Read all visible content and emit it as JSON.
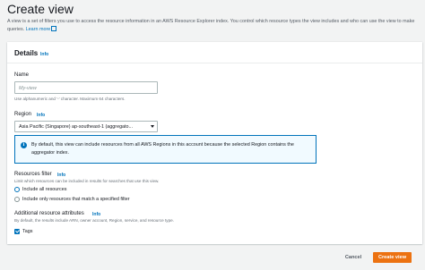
{
  "page": {
    "title": "Create view",
    "description": "A view is a set of filters you use to access the resource information in an AWS Resource Explorer index. You control which resource types the view includes and who can use the view to make queries.",
    "learn_more": "Learn more"
  },
  "details": {
    "header": "Details",
    "info": "Info",
    "name": {
      "label": "Name",
      "placeholder": "My-view",
      "hint": "Use alphanumeric and '-' character. Maximum 64 characters."
    },
    "region": {
      "label": "Region",
      "info": "Info",
      "selected": "Asia Pacific (Singapore) ap-southeast-1 (aggregato..."
    },
    "alert": "By default, this view can include resources from all AWS Regions in this account because the selected Region contains the aggregator index.",
    "resources_filter": {
      "label": "Resources filter",
      "info": "Info",
      "hint": "Limit which resources can be included in results for searches that use this view.",
      "options": [
        "Include all resources",
        "Include only resources that match a specified filter"
      ],
      "selected_index": 0
    },
    "additional_attributes": {
      "label": "Additional resource attributes",
      "info": "Info",
      "hint": "By default, the results include ARN, owner account, Region, service, and resource type.",
      "tags_label": "Tags",
      "tags_checked": true
    }
  },
  "actions": {
    "cancel": "Cancel",
    "create": "Create view"
  },
  "colors": {
    "accent": "#0073bb",
    "primary_button": "#ec7211",
    "alert_bg": "#f1faff"
  }
}
